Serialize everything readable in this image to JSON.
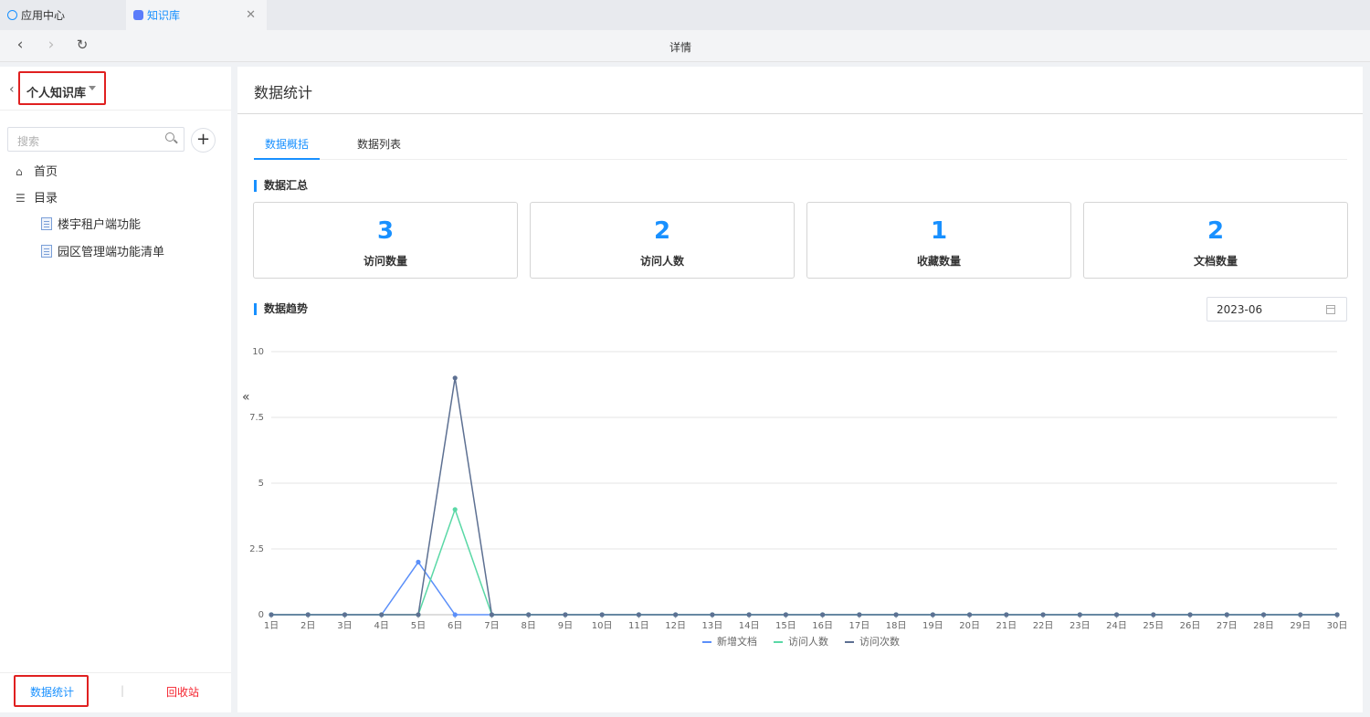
{
  "tabs": [
    {
      "label": "应用中心",
      "icon": "app-center-icon"
    },
    {
      "label": "知识库",
      "icon": "knowledge-icon",
      "active": true
    }
  ],
  "nav": {
    "title": "详情"
  },
  "sidebar": {
    "kb_name": "个人知识库",
    "search_placeholder": "搜索",
    "menu": [
      {
        "label": "首页",
        "icon": "home-icon"
      },
      {
        "label": "目录",
        "icon": "catalog-icon"
      }
    ],
    "docs": [
      "楼宇租户端功能",
      "园区管理端功能清单"
    ],
    "footer": {
      "stats_label": "数据统计",
      "recycle_label": "回收站"
    }
  },
  "main": {
    "title": "数据统计",
    "tabs": [
      {
        "label": "数据概括",
        "active": true
      },
      {
        "label": "数据列表",
        "active": false
      }
    ],
    "summary_title": "数据汇总",
    "cards": [
      {
        "value": "3",
        "label": "访问数量"
      },
      {
        "value": "2",
        "label": "访问人数"
      },
      {
        "value": "1",
        "label": "收藏数量"
      },
      {
        "value": "2",
        "label": "文档数量"
      }
    ],
    "trend_title": "数据趋势",
    "month_value": "2023-06"
  },
  "colors": {
    "accent": "#1890ff",
    "danger": "#f5222d",
    "series_new_docs": "#5b8ff9",
    "series_visitors": "#5ad8a6",
    "series_visits": "#5d7092"
  },
  "chart_data": {
    "type": "line",
    "x": [
      "1日",
      "2日",
      "3日",
      "4日",
      "5日",
      "6日",
      "7日",
      "8日",
      "9日",
      "10日",
      "11日",
      "12日",
      "13日",
      "14日",
      "15日",
      "16日",
      "17日",
      "18日",
      "19日",
      "20日",
      "21日",
      "22日",
      "23日",
      "24日",
      "25日",
      "26日",
      "27日",
      "28日",
      "29日",
      "30日"
    ],
    "yticks": [
      "0",
      "2.5",
      "5",
      "7.5",
      "10"
    ],
    "ylim": [
      0,
      10
    ],
    "grid": true,
    "legend_position": "bottom",
    "series": [
      {
        "name": "新增文档",
        "values": [
          0,
          0,
          0,
          0,
          2,
          0,
          0,
          0,
          0,
          0,
          0,
          0,
          0,
          0,
          0,
          0,
          0,
          0,
          0,
          0,
          0,
          0,
          0,
          0,
          0,
          0,
          0,
          0,
          0,
          0
        ]
      },
      {
        "name": "访问人数",
        "values": [
          0,
          0,
          0,
          0,
          0,
          4,
          0,
          0,
          0,
          0,
          0,
          0,
          0,
          0,
          0,
          0,
          0,
          0,
          0,
          0,
          0,
          0,
          0,
          0,
          0,
          0,
          0,
          0,
          0,
          0
        ]
      },
      {
        "name": "访问次数",
        "values": [
          0,
          0,
          0,
          0,
          0,
          9,
          0,
          0,
          0,
          0,
          0,
          0,
          0,
          0,
          0,
          0,
          0,
          0,
          0,
          0,
          0,
          0,
          0,
          0,
          0,
          0,
          0,
          0,
          0,
          0
        ]
      }
    ]
  }
}
